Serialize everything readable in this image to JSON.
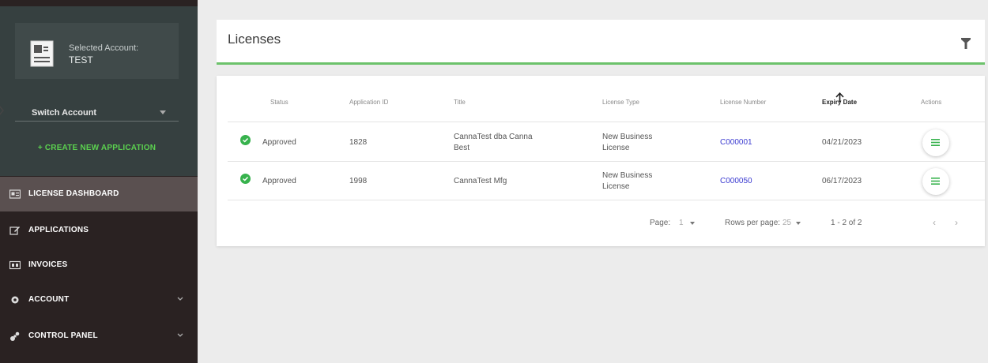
{
  "sidebar": {
    "account": {
      "label": "Selected Account:",
      "name": "TEST"
    },
    "switch_label": "Switch Account",
    "create_label": "+ CREATE NEW APPLICATION",
    "nav": [
      {
        "label": "LICENSE DASHBOARD",
        "icon": "id-card-icon",
        "active": true
      },
      {
        "label": "APPLICATIONS",
        "icon": "edit-icon"
      },
      {
        "label": "INVOICES",
        "icon": "invoice-icon"
      },
      {
        "label": "ACCOUNT",
        "icon": "gear-icon",
        "expandable": true
      },
      {
        "label": "CONTROL PANEL",
        "icon": "control-panel-icon",
        "expandable": true
      }
    ]
  },
  "header": {
    "title": "Licenses"
  },
  "table": {
    "columns": [
      "Status",
      "Application ID",
      "Title",
      "License Type",
      "License Number",
      "Expiry Date",
      "Actions"
    ],
    "sorted_column": "Expiry Date",
    "rows": [
      {
        "status": "Approved",
        "app_id": "1828",
        "title_1": "CannaTest dba Canna",
        "title_2": "Best",
        "type_1": "New Business",
        "type_2": "License",
        "license_number": "C000001",
        "expiry": "04/21/2023"
      },
      {
        "status": "Approved",
        "app_id": "1998",
        "title_1": "CannaTest Mfg",
        "title_2": "",
        "type_1": "New Business",
        "type_2": "License",
        "license_number": "C000050",
        "expiry": "06/17/2023"
      }
    ],
    "pagination": {
      "page_label": "Page:",
      "page_value": "1",
      "rows_label": "Rows per page:",
      "rows_value": "25",
      "range": "1 - 2 of 2"
    }
  },
  "colors": {
    "accent_green": "#6cc26b",
    "status_green": "#37b24d",
    "link_blue": "#3a3ad0",
    "sidebar_dark": "#2a2222"
  }
}
